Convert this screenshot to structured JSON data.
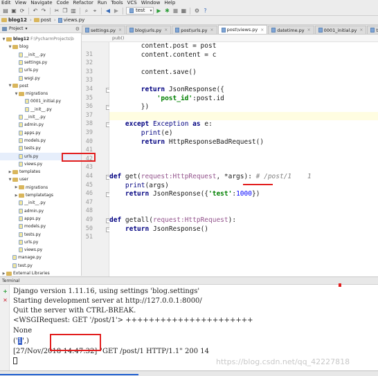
{
  "menu": [
    "Edit",
    "View",
    "Navigate",
    "Code",
    "Refactor",
    "Run",
    "Tools",
    "VCS",
    "Window",
    "Help"
  ],
  "toolbar": {
    "run_config": "test"
  },
  "nav": {
    "crumbs": [
      "blog12",
      "post",
      "views.py"
    ]
  },
  "project_panel": {
    "title": "Project"
  },
  "tree": [
    {
      "label": "blog12",
      "extra": "F:\\PycharmProjects\\b",
      "indent": 0,
      "type": "folder",
      "expanded": true,
      "bold": true
    },
    {
      "label": "blog",
      "indent": 1,
      "type": "folder",
      "expanded": true
    },
    {
      "label": "__init__.py",
      "indent": 2,
      "type": "py"
    },
    {
      "label": "settings.py",
      "indent": 2,
      "type": "py"
    },
    {
      "label": "urls.py",
      "indent": 2,
      "type": "py"
    },
    {
      "label": "wsgi.py",
      "indent": 2,
      "type": "py"
    },
    {
      "label": "post",
      "indent": 1,
      "type": "folder",
      "expanded": true
    },
    {
      "label": "migrations",
      "indent": 2,
      "type": "folder",
      "expanded": true
    },
    {
      "label": "0001_initial.py",
      "indent": 3,
      "type": "py"
    },
    {
      "label": "__init__.py",
      "indent": 3,
      "type": "py"
    },
    {
      "label": "__init__.py",
      "indent": 2,
      "type": "py"
    },
    {
      "label": "admin.py",
      "indent": 2,
      "type": "py"
    },
    {
      "label": "apps.py",
      "indent": 2,
      "type": "py"
    },
    {
      "label": "models.py",
      "indent": 2,
      "type": "py"
    },
    {
      "label": "tests.py",
      "indent": 2,
      "type": "py"
    },
    {
      "label": "urls.py",
      "indent": 2,
      "type": "py",
      "selected": true
    },
    {
      "label": "views.py",
      "indent": 2,
      "type": "py"
    },
    {
      "label": "templates",
      "indent": 1,
      "type": "folder",
      "expanded": false
    },
    {
      "label": "user",
      "indent": 1,
      "type": "folder",
      "expanded": true
    },
    {
      "label": "migrations",
      "indent": 2,
      "type": "folder",
      "expanded": false
    },
    {
      "label": "templatetags",
      "indent": 2,
      "type": "folder",
      "expanded": false
    },
    {
      "label": "__init__.py",
      "indent": 2,
      "type": "py"
    },
    {
      "label": "admin.py",
      "indent": 2,
      "type": "py"
    },
    {
      "label": "apps.py",
      "indent": 2,
      "type": "py"
    },
    {
      "label": "models.py",
      "indent": 2,
      "type": "py"
    },
    {
      "label": "tests.py",
      "indent": 2,
      "type": "py"
    },
    {
      "label": "urls.py",
      "indent": 2,
      "type": "py"
    },
    {
      "label": "views.py",
      "indent": 2,
      "type": "py"
    },
    {
      "label": "manage.py",
      "indent": 1,
      "type": "py"
    },
    {
      "label": "test.py",
      "indent": 1,
      "type": "py"
    },
    {
      "label": "External Libraries",
      "indent": 0,
      "type": "folder",
      "expanded": false
    }
  ],
  "tabs": [
    {
      "label": "settings.py",
      "active": false
    },
    {
      "label": "blog\\urls.py",
      "active": false
    },
    {
      "label": "post\\urls.py",
      "active": false
    },
    {
      "label": "post\\views.py",
      "active": true
    },
    {
      "label": "datetime.py",
      "active": false
    },
    {
      "label": "0001_initial.py",
      "active": false
    },
    {
      "label": "test.py",
      "active": false
    }
  ],
  "editor": {
    "breadcrumb": "pub()",
    "lines": [
      {
        "no": "",
        "code": "        content.post = post"
      },
      {
        "no": "31",
        "code": "        content.content = c"
      },
      {
        "no": "32",
        "code": ""
      },
      {
        "no": "33",
        "code": "        content.save()"
      },
      {
        "no": "33",
        "code": ""
      },
      {
        "no": "34",
        "code": "        return JsonResponse({"
      },
      {
        "no": "35",
        "code": "            'post_id':post.id"
      },
      {
        "no": "36",
        "code": "        })"
      },
      {
        "no": "37",
        "code": ""
      },
      {
        "no": "38",
        "code": "    except Exception as e:"
      },
      {
        "no": "39",
        "code": "        print(e)"
      },
      {
        "no": "40",
        "code": "        return HttpResponseBadRequest()"
      },
      {
        "no": "41",
        "code": ""
      },
      {
        "no": "42",
        "code": ""
      },
      {
        "no": "43",
        "code": ""
      },
      {
        "no": "44",
        "code": "def get(request:HttpRequest, *args): # /post/1    1"
      },
      {
        "no": "45",
        "code": "    print(args)"
      },
      {
        "no": "46",
        "code": "    return JsonResponse({'test':1000})"
      },
      {
        "no": "47",
        "code": ""
      },
      {
        "no": "48",
        "code": ""
      },
      {
        "no": "49",
        "code": "def getall(request:HttpRequest):"
      },
      {
        "no": "50",
        "code": "    return JsonResponse()"
      },
      {
        "no": "51",
        "code": ""
      }
    ]
  },
  "terminal": {
    "title": "Terminal",
    "lines": [
      "Django version 1.11.16, using settings 'blog.settings'",
      "Starting development server at http://127.0.0.1:8000/",
      "Quit the server with CTRL-BREAK.",
      "<WSGIRequest: GET '/post/1'> ++++++++++++++++++++++",
      "None",
      "",
      "[27/Nov/2018 14:47:32] \"GET /post/1 HTTP/1.1\" 200 14"
    ],
    "tuple_prefix": "('",
    "tuple_value": "1",
    "tuple_suffix": "',)"
  },
  "watermark": "https://blog.csdn.net/qq_42227818",
  "colors": {
    "annotation_red": "#e21d1d",
    "selection_blue": "#3b63c9"
  }
}
